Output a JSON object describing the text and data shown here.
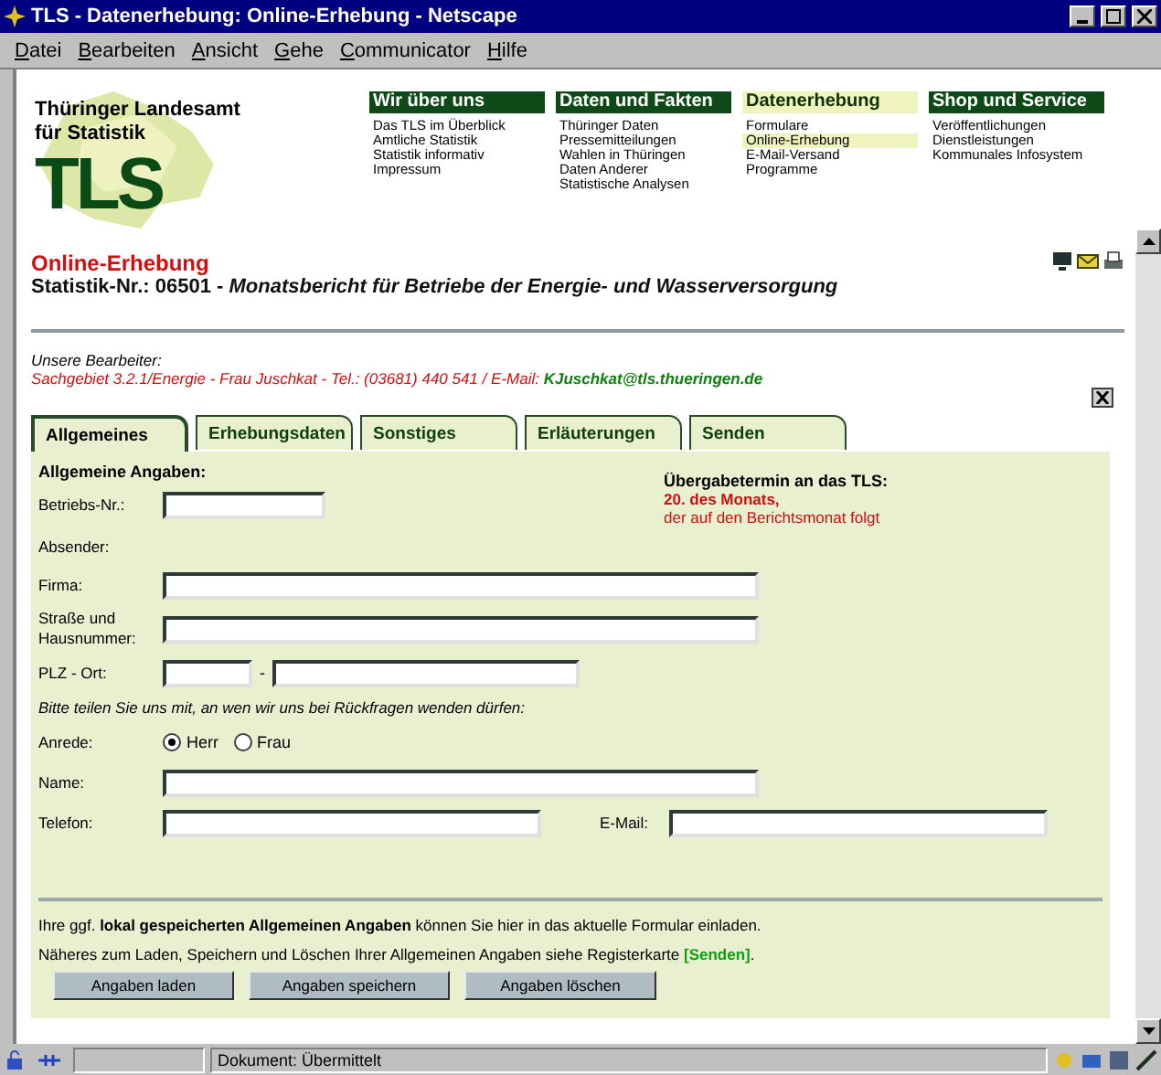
{
  "window": {
    "title": "TLS - Datenerhebung: Online-Erhebung - Netscape"
  },
  "menu": [
    "Datei",
    "Bearbeiten",
    "Ansicht",
    "Gehe",
    "Communicator",
    "Hilfe"
  ],
  "header": {
    "org_name": "Thüringer Landesamt für Statistik",
    "logo_text": "TLS",
    "nav": [
      {
        "heading": "Wir über uns",
        "selected": false,
        "items": [
          {
            "label": "Das TLS im Überblick",
            "selected": false
          },
          {
            "label": "Amtliche Statistik",
            "selected": false
          },
          {
            "label": "Statistik informativ",
            "selected": false
          },
          {
            "label": "Impressum",
            "selected": false
          }
        ]
      },
      {
        "heading": "Daten und Fakten",
        "selected": false,
        "items": [
          {
            "label": "Thüringer Daten",
            "selected": false
          },
          {
            "label": "Pressemitteilungen",
            "selected": false
          },
          {
            "label": "Wahlen in Thüringen",
            "selected": false
          },
          {
            "label": "Daten Anderer",
            "selected": false
          },
          {
            "label": "Statistische Analysen",
            "selected": false
          }
        ]
      },
      {
        "heading": "Datenerhebung",
        "selected": true,
        "items": [
          {
            "label": "Formulare",
            "selected": false
          },
          {
            "label": "Online-Erhebung",
            "selected": true
          },
          {
            "label": "E-Mail-Versand",
            "selected": false
          },
          {
            "label": "Programme",
            "selected": false
          }
        ]
      },
      {
        "heading": "Shop und Service",
        "selected": false,
        "items": [
          {
            "label": "Veröffentlichungen",
            "selected": false
          },
          {
            "label": "Dienstleistungen",
            "selected": false
          },
          {
            "label": "Kommunales Infosystem",
            "selected": false
          }
        ]
      }
    ]
  },
  "page": {
    "heading": "Online-Erhebung",
    "statistik_nr": "Statistik-Nr.: 06501 - ",
    "survey_title": "Monatsbericht für Betriebe der Energie- und Wasserversorgung",
    "contact_label": "Unsere Bearbeiter:",
    "contact_text": "Sachgebiet 3.2.1/Energie - Frau Juschkat - Tel.: (03681) 440 541 / E-Mail: ",
    "contact_email": "KJuschkat@tls.thueringen.de"
  },
  "tabs": [
    {
      "label": "Allgemeines",
      "selected": true
    },
    {
      "label": "Erhebungsdaten",
      "selected": false
    },
    {
      "label": "Sonstiges",
      "selected": false
    },
    {
      "label": "Erläuterungen",
      "selected": false
    },
    {
      "label": "Senden",
      "selected": false
    }
  ],
  "form": {
    "section_title": "Allgemeine Angaben:",
    "deadline": {
      "title": "Übergabetermin an das TLS:",
      "date": "20. des Monats,",
      "note": "der auf den Berichtsmonat folgt"
    },
    "betriebs_nr": {
      "label": "Betriebs-Nr.:"
    },
    "absender_label": "Absender:",
    "firma": {
      "label": "Firma:"
    },
    "strasse": {
      "label": "Straße und Hausnummer:"
    },
    "plz_ort": {
      "label": "PLZ - Ort:",
      "separator": "-"
    },
    "contact_note": "Bitte teilen Sie uns mit, an wen wir uns bei Rückfragen wenden dürfen:",
    "anrede": {
      "label": "Anrede:",
      "options": [
        {
          "label": "Herr",
          "selected": true
        },
        {
          "label": "Frau",
          "selected": false
        }
      ]
    },
    "name": {
      "label": "Name:"
    },
    "telefon": {
      "label": "Telefon:"
    },
    "email": {
      "label": "E-Mail:"
    },
    "load_text": "Ihre ggf. **lokal gespeicherten Allgemeinen Angaben** können Sie hier in das aktuelle Formular einladen.",
    "more_text": "Näheres zum Laden, Speichern und Löschen Ihrer Allgemeinen Angaben siehe Registerkarte  **[Senden]**.",
    "buttons": [
      "Angaben laden",
      "Angaben speichern",
      "Angaben löschen"
    ]
  },
  "status_bar": {
    "text": "Dokument: Übermittelt"
  }
}
